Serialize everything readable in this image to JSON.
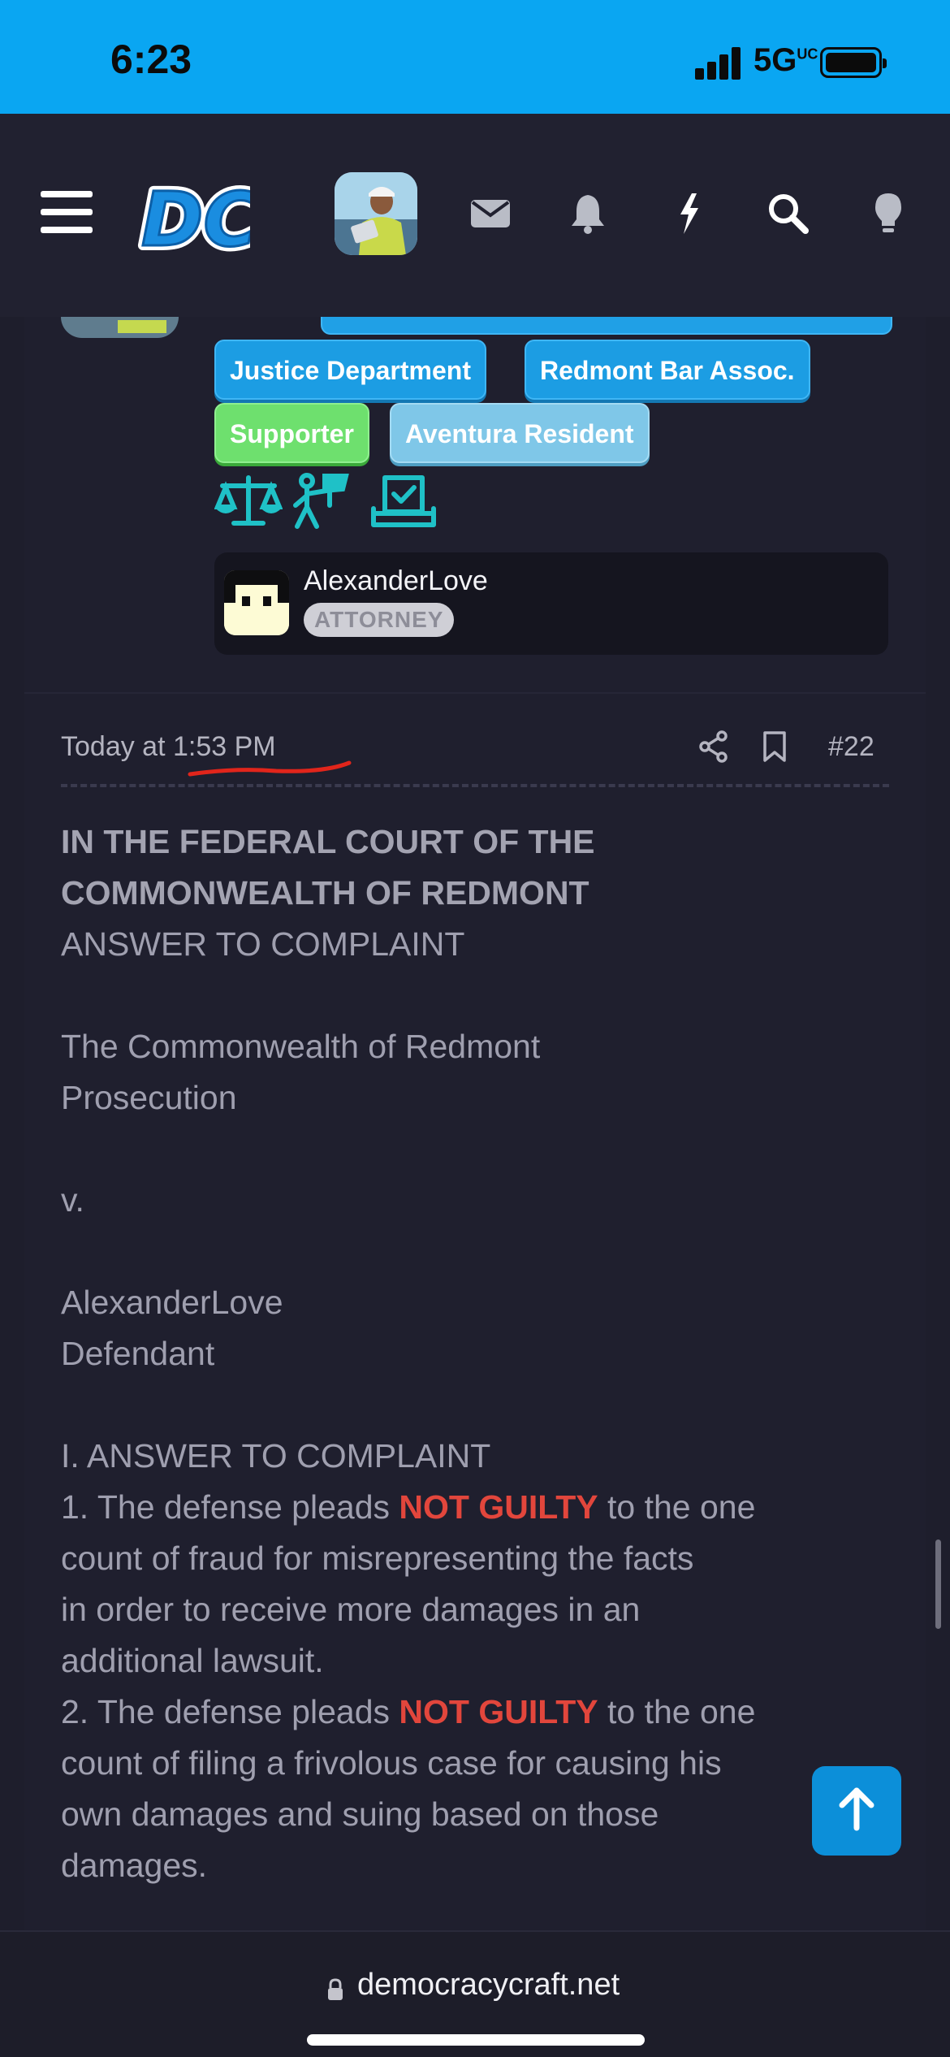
{
  "status_bar": {
    "time": "6:23",
    "network": "5G",
    "network_sup": "UC"
  },
  "header": {
    "logo_text": "DC",
    "icons": [
      "menu-icon",
      "envelope-icon",
      "bell-icon",
      "lightning-icon",
      "search-icon",
      "lightbulb-icon"
    ]
  },
  "profile": {
    "badges": [
      "Justice Department",
      "Redmont Bar Assoc.",
      "Supporter",
      "Aventura Resident"
    ],
    "award_icons": [
      "scales-of-justice-icon",
      "protester-icon",
      "ballot-box-icon"
    ],
    "user_card": {
      "name": "AlexanderLove",
      "role": "ATTORNEY"
    }
  },
  "post": {
    "time_prefix": "Today at ",
    "time": "1:53 PM",
    "number": "#22",
    "body": {
      "heading1": "IN THE FEDERAL COURT OF THE",
      "heading2": "COMMONWEALTH OF REDMONT",
      "subtitle": "ANSWER TO COMPLAINT",
      "plaintiff1": "The Commonwealth of Redmont",
      "plaintiff2": "Prosecution",
      "versus": "v.",
      "defendant1": "AlexanderLove",
      "defendant2": "Defendant",
      "section": "I. ANSWER TO COMPLAINT",
      "p1_pre": "1. The defense pleads ",
      "p1_red": "NOT GUILTY",
      "p1_post": " to the one",
      "p1_l2": "count of fraud for misrepresenting the facts",
      "p1_l3": "in order to receive more damages in an",
      "p1_l4": "additional lawsuit.",
      "p2_pre": "2. The defense pleads ",
      "p2_red": "NOT GUILTY",
      "p2_post": " to the one",
      "p2_l2": "count of filing a frivolous case for causing his",
      "p2_l3": "own damages and suing based on those",
      "p2_l4": "damages."
    }
  },
  "footer": {
    "url": "democracycraft.net"
  },
  "colors": {
    "accent": "#0aa6f2",
    "badge_blue": "#1c9de3",
    "badge_green": "#6ee06e",
    "not_guilty_red": "#e2463c",
    "background": "#1e1e2c"
  }
}
